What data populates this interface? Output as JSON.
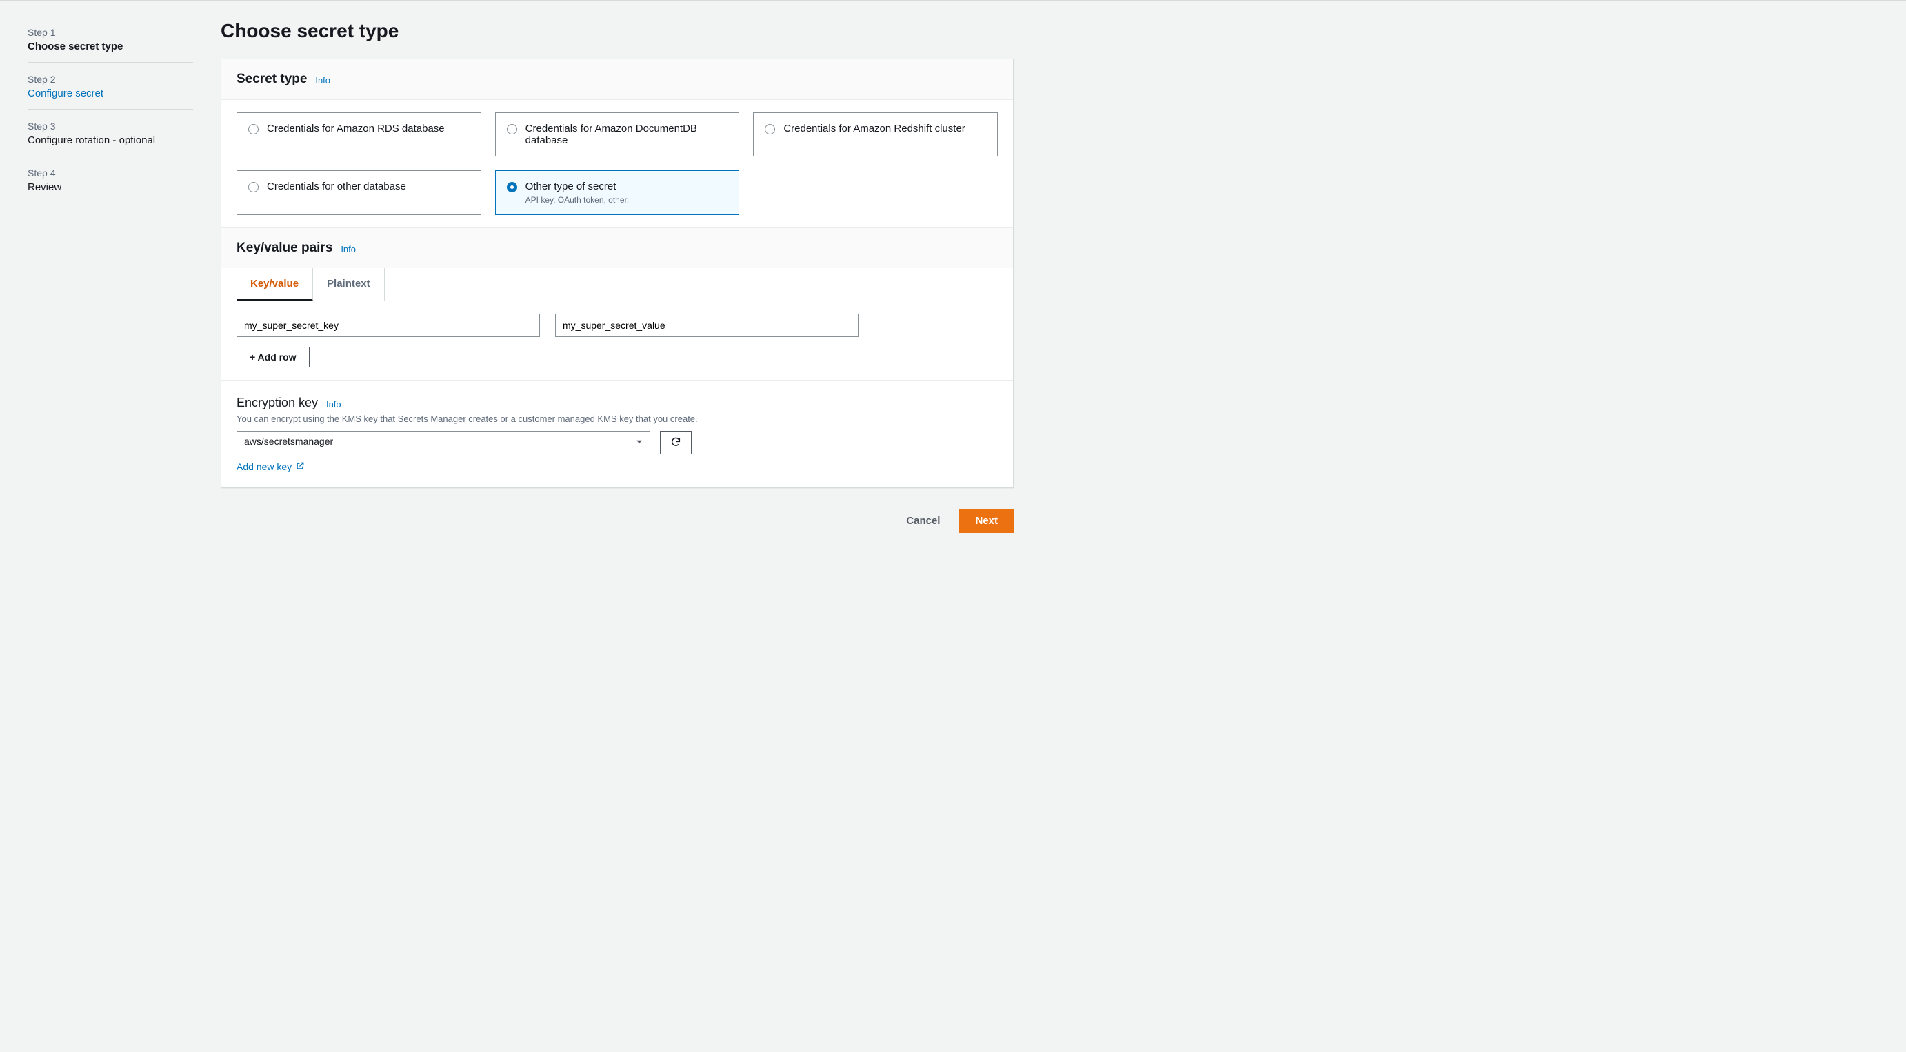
{
  "sidebar": {
    "steps": [
      {
        "label": "Step 1",
        "name": "Choose secret type",
        "active": true
      },
      {
        "label": "Step 2",
        "name": "Configure secret",
        "link": true
      },
      {
        "label": "Step 3",
        "name": "Configure rotation - optional"
      },
      {
        "label": "Step 4",
        "name": "Review"
      }
    ]
  },
  "page_title": "Choose secret type",
  "secret_type": {
    "heading": "Secret type",
    "info": "Info",
    "options": [
      {
        "label": "Credentials for Amazon RDS database"
      },
      {
        "label": "Credentials for Amazon DocumentDB database"
      },
      {
        "label": "Credentials for Amazon Redshift cluster"
      },
      {
        "label": "Credentials for other database"
      },
      {
        "label": "Other type of secret",
        "sub": "API key, OAuth token, other.",
        "selected": true
      }
    ]
  },
  "kv": {
    "heading": "Key/value pairs",
    "info": "Info",
    "tabs": [
      "Key/value",
      "Plaintext"
    ],
    "active_tab": 0,
    "row": {
      "key": "my_super_secret_key",
      "value": "my_super_secret_value"
    },
    "add_row_label": "+ Add row"
  },
  "encryption": {
    "heading": "Encryption key",
    "info": "Info",
    "desc": "You can encrypt using the KMS key that Secrets Manager creates or a customer managed KMS key that you create.",
    "selected": "aws/secretsmanager",
    "add_new_key": "Add new key"
  },
  "footer": {
    "cancel": "Cancel",
    "next": "Next"
  }
}
